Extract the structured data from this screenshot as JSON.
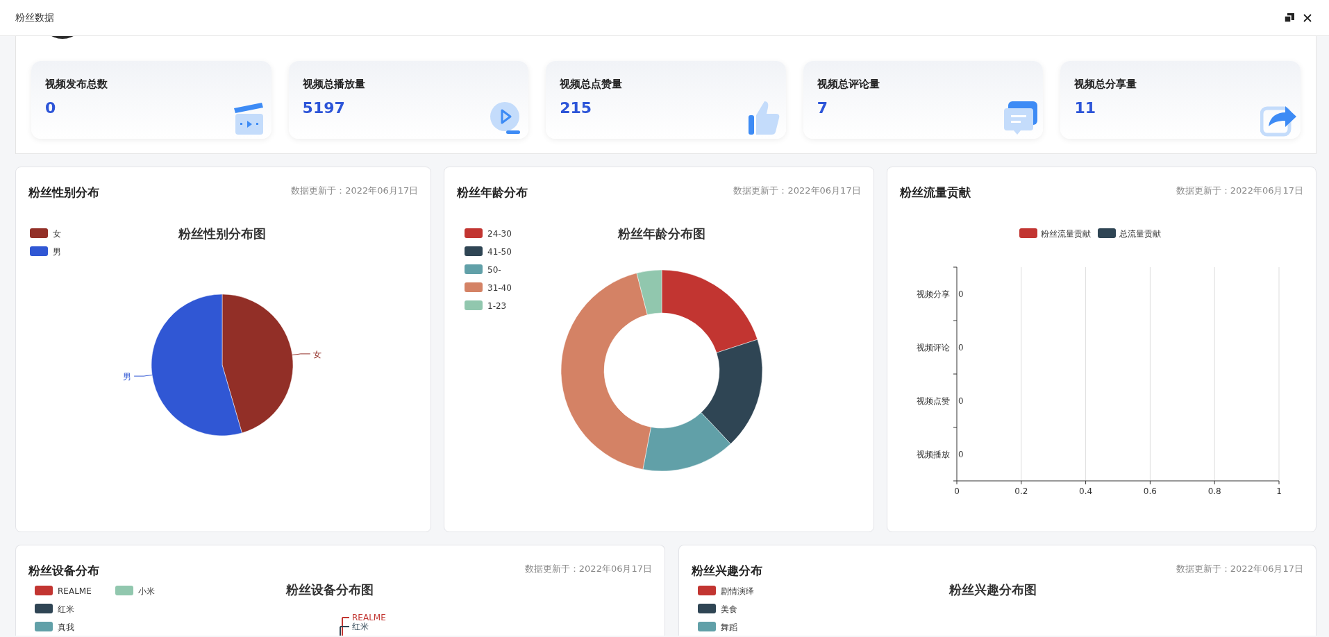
{
  "window": {
    "title": "粉丝数据"
  },
  "stats": [
    {
      "label": "视频发布总数",
      "value": "0"
    },
    {
      "label": "视频总播放量",
      "value": "5197"
    },
    {
      "label": "视频总点赞量",
      "value": "215"
    },
    {
      "label": "视频总评论量",
      "value": "7"
    },
    {
      "label": "视频总分享量",
      "value": "11"
    }
  ],
  "panels": [
    {
      "title": "粉丝性别分布",
      "updated": "数据更新于：2022年06月17日",
      "legend": [
        {
          "label": "女",
          "color": "#922f27"
        },
        {
          "label": "男",
          "color": "#3057d4"
        }
      ],
      "chart_data": {
        "type": "pie",
        "title": "粉丝性别分布图",
        "categories": [
          "女",
          "男"
        ],
        "values": [
          45.5,
          54.5
        ]
      }
    },
    {
      "title": "粉丝年龄分布",
      "updated": "数据更新于：2022年06月17日",
      "legend": [
        {
          "label": "24-30",
          "color": "#c23531"
        },
        {
          "label": "41-50",
          "color": "#2f4554"
        },
        {
          "label": "50-",
          "color": "#61a0a8"
        },
        {
          "label": "31-40",
          "color": "#d48265"
        },
        {
          "label": "1-23",
          "color": "#91c7ae"
        }
      ],
      "chart_data": {
        "type": "donut",
        "title": "粉丝年龄分布图",
        "values": [
          20,
          18,
          15,
          43,
          4
        ]
      }
    },
    {
      "title": "粉丝流量贡献",
      "updated": "数据更新于：2022年06月17日",
      "chart_data": {
        "type": "bar",
        "orientation": "horizontal",
        "categories": [
          "视频分享",
          "视频评论",
          "视频点赞",
          "视频播放"
        ],
        "series": [
          {
            "name": "粉丝流量贡献",
            "color": "#c23531",
            "values": [
              0,
              0,
              0,
              0
            ]
          },
          {
            "name": "总流量贡献",
            "color": "#2f4554",
            "values": [
              0,
              0,
              0,
              0
            ]
          }
        ],
        "xlim": [
          0,
          1
        ],
        "xticks": [
          0,
          0.2,
          0.4,
          0.6,
          0.8,
          1
        ],
        "value_labels": [
          [
            "0",
            "0",
            "0",
            "0"
          ],
          [
            null,
            null,
            null,
            null
          ]
        ],
        "grid": true
      }
    },
    {
      "title": "粉丝设备分布",
      "updated": "数据更新于：2022年06月17日",
      "chart_title": "粉丝设备分布图",
      "legend": [
        {
          "label": "REALME",
          "color": "#c23531"
        },
        {
          "label": "红米",
          "color": "#2f4554"
        },
        {
          "label": "真我",
          "color": "#61a0a8"
        },
        {
          "label": "小米",
          "color": "#91c7ae"
        }
      ],
      "slice_labels": [
        {
          "label": "REALME",
          "color": "#c23531"
        },
        {
          "label": "红米",
          "color": "#2f4554"
        }
      ]
    },
    {
      "title": "粉丝兴趣分布",
      "updated": "数据更新于：2022年06月17日",
      "chart_title": "粉丝兴趣分布图",
      "legend": [
        {
          "label": "剧情演绎",
          "color": "#c23531"
        },
        {
          "label": "美食",
          "color": "#2f4554"
        },
        {
          "label": "舞蹈",
          "color": "#61a0a8"
        }
      ]
    }
  ]
}
